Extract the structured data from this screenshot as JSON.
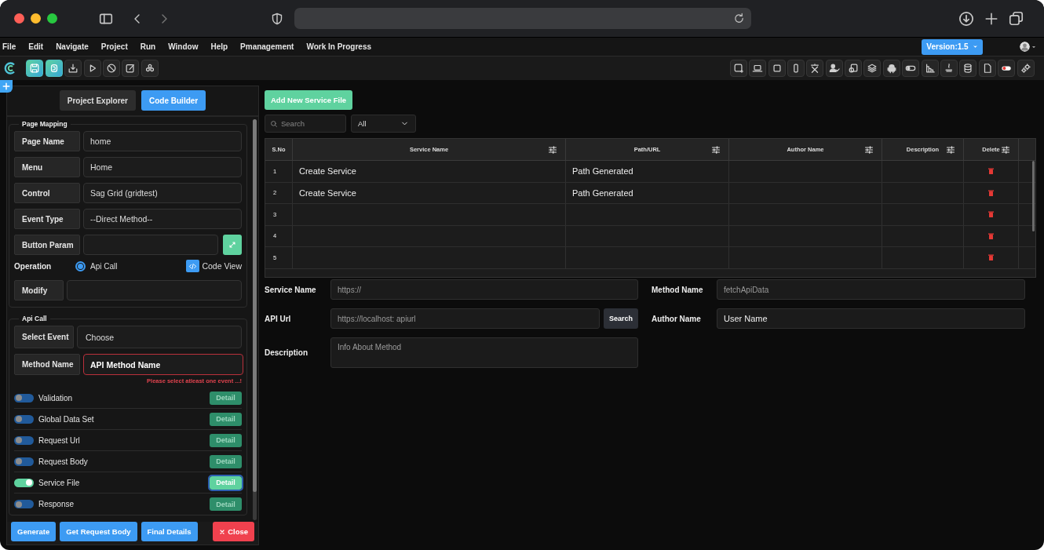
{
  "menu": [
    "File",
    "Edit",
    "Navigate",
    "Project",
    "Run",
    "Window",
    "Help",
    "Pmanagement",
    "Work In Progress"
  ],
  "version": "Version:1.5",
  "toolbar": {
    "left": [
      {
        "active": true
      },
      {
        "active": true
      },
      {
        "active": false
      },
      {
        "active": false
      },
      {
        "active": false
      },
      {
        "active": false
      },
      {
        "active": false
      }
    ]
  },
  "side_panel": {
    "tabs": [
      {
        "label": "Project Explorer",
        "selected": false
      },
      {
        "label": "Code Builder",
        "selected": true
      }
    ],
    "page_mapping": {
      "title": "Page Mapping",
      "fields": [
        {
          "label": "Page Name",
          "value": "home"
        },
        {
          "label": "Menu",
          "value": "Home"
        },
        {
          "label": "Control",
          "value": "Sag Grid (gridtest)"
        },
        {
          "label": "Event Type",
          "value": "--Direct Method--"
        },
        {
          "label": "Button Param"
        }
      ],
      "operation": {
        "label": "Operation",
        "option": {
          "label": "Api Call",
          "selected": true
        },
        "code_view": "Code View"
      },
      "modify": {
        "label": "Modify"
      }
    },
    "api_call": {
      "title": "Api Call",
      "select_event": {
        "label": "Select Event",
        "value": "Choose"
      },
      "method_name": {
        "label": "Method Name",
        "value": "API Method Name",
        "error": "Please select atleast one event ...!"
      },
      "options": [
        {
          "label": "Validation",
          "on": false,
          "detail": "Detail",
          "focused": false
        },
        {
          "label": "Global Data Set",
          "on": false,
          "detail": "Detail",
          "focused": false
        },
        {
          "label": "Request Url",
          "on": false,
          "detail": "Detail",
          "focused": false
        },
        {
          "label": "Request Body",
          "on": false,
          "detail": "Detail",
          "focused": false
        },
        {
          "label": "Service File",
          "on": true,
          "detail": "Detail",
          "focused": true
        },
        {
          "label": "Response",
          "on": false,
          "detail": "Detail",
          "focused": false
        }
      ]
    },
    "buttons": [
      {
        "label": "Generate",
        "kind": "primary"
      },
      {
        "label": "Get Request Body",
        "kind": "primary"
      },
      {
        "label": "Final Details",
        "kind": "primary"
      },
      {
        "label": "Close",
        "kind": "danger"
      }
    ]
  },
  "service_view": {
    "add_button": "Add New Service File",
    "search": {
      "placeholder": "Search"
    },
    "filter": "All",
    "table": {
      "columns": [
        "S.No",
        "Service Name",
        "Path/URL",
        "Author Name",
        "Description",
        "Delete"
      ],
      "rows": [
        {
          "sno": "1",
          "service_name": "Create Service",
          "path": "Path Generated"
        },
        {
          "sno": "2",
          "service_name": "Create Service",
          "path": "Path Generated"
        },
        {
          "sno": "3"
        },
        {
          "sno": "4"
        },
        {
          "sno": "5"
        }
      ]
    },
    "form": {
      "service_name": {
        "label": "Service Name",
        "placeholder": "https://"
      },
      "api_url": {
        "label": "API Url",
        "placeholder": "https://localhost: apiurl",
        "button": "Search"
      },
      "description": {
        "label": "Description",
        "placeholder": "Info About Method"
      },
      "method_name": {
        "label": "Method Name",
        "placeholder": "fetchApiData"
      },
      "author_name": {
        "label": "Author Name",
        "value": "User Name"
      }
    }
  }
}
